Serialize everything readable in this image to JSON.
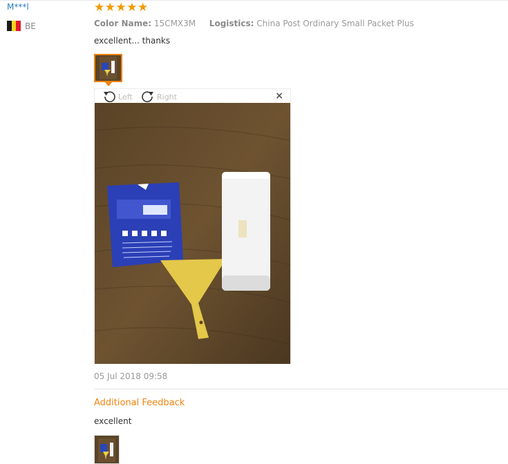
{
  "user": {
    "name": "M***l",
    "country_code": "BE",
    "flag_colors": [
      "#1b1b1b",
      "#f7d21e",
      "#e01b2b"
    ]
  },
  "review": {
    "rating": 5,
    "star_glyph": "★",
    "star_color": "#f29a00",
    "color_label": "Color Name:",
    "color_value": "15CMX3M",
    "logistics_label": "Logistics:",
    "logistics_value": "China Post Ordinary Small Packet Plus",
    "text": "excellent... thanks",
    "date": "05 Jul 2018 09:58"
  },
  "viewer": {
    "rotate_left_label": "Left",
    "rotate_right_label": "Right",
    "close_glyph": "×"
  },
  "additional": {
    "title": "Additional Feedback",
    "text": "excellent"
  },
  "colors": {
    "accent": "#f0840f",
    "username": "#2e7bc4"
  }
}
